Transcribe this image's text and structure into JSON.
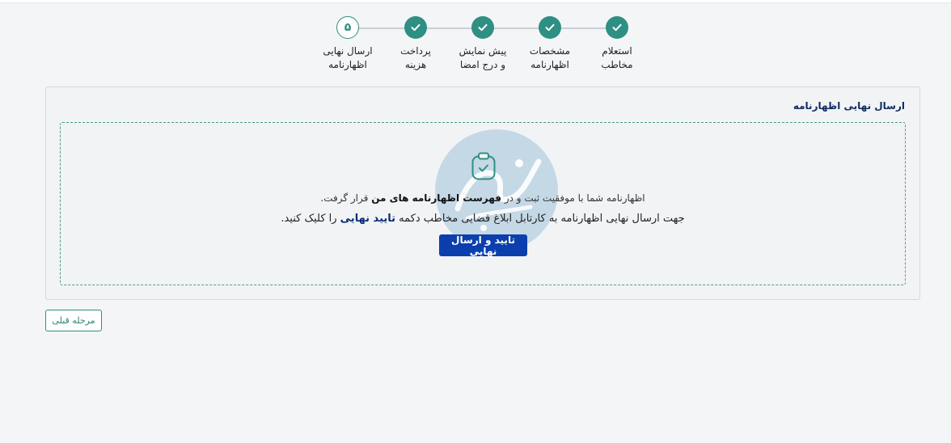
{
  "stepper": {
    "steps": [
      {
        "label_line1": "استعلام",
        "label_line2": "مخاطب",
        "status": "done"
      },
      {
        "label_line1": "مشخصات",
        "label_line2": "اظهارنامه",
        "status": "done"
      },
      {
        "label_line1": "پیش نمایش",
        "label_line2": "و درج امضا",
        "status": "done"
      },
      {
        "label_line1": "پرداخت",
        "label_line2": "هزینه",
        "status": "done"
      },
      {
        "label_line1": "ارسال نهایی",
        "label_line2": "اظهارنامه",
        "status": "active",
        "number": "۵"
      }
    ]
  },
  "card": {
    "title": "ارسال نهایی اظهارنامه",
    "watermark_text": "وکلاپرس",
    "message1_prefix": "اظهارنامه شما با موفقیت ثبت و در ",
    "message1_bold": "فهرست اظهارنامه های من",
    "message1_suffix": " قرار گرفت.",
    "message2_prefix": "جهت ارسال نهایی اظهارنامه به کارتابل ابلاغ قضایی مخاطب دکمه ",
    "message2_bold": "تایید نهایی",
    "message2_suffix": " را کلیک کنید.",
    "confirm_button": "تایید و ارسال نهایی"
  },
  "footer": {
    "prev_button": "مرحله قبلی"
  },
  "colors": {
    "accent": "#2f8f83",
    "primary_button": "#0b3fae",
    "title": "#0f2d63"
  }
}
